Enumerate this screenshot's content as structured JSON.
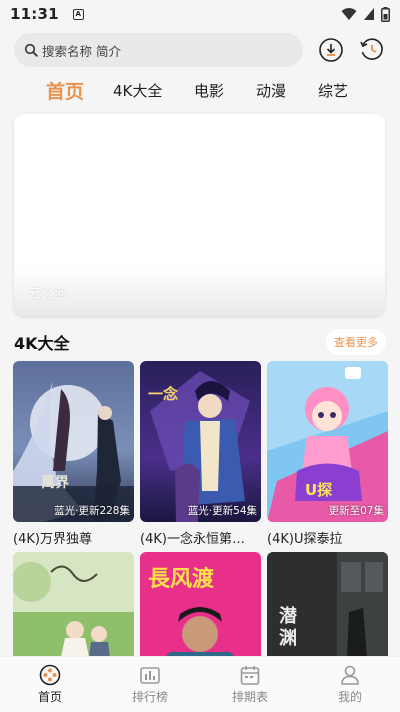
{
  "statusbar": {
    "time": "11:31"
  },
  "search": {
    "placeholder": "搜索名称 简介"
  },
  "tabs": [
    "首页",
    "4K大全",
    "电影",
    "动漫",
    "综艺"
  ],
  "active_tab": "首页",
  "banner": {
    "caption": "云之羽"
  },
  "section": {
    "title": "4K大全",
    "more": "查看更多"
  },
  "cards": [
    {
      "title": "(4K)万界独尊",
      "badge": "蓝光·更新228集"
    },
    {
      "title": "(4K)一念永恒第…",
      "badge": "蓝光·更新54集"
    },
    {
      "title": "(4K)U探泰拉",
      "badge": "更新至07集"
    }
  ],
  "poster_text": {
    "p2": "長风渡"
  },
  "bottom_nav": [
    "首页",
    "排行榜",
    "排期表",
    "我的"
  ],
  "colors": {
    "accent": "#e8924f",
    "background": "#f5f5f5",
    "search_bg": "#e9e9e9"
  },
  "icons": {
    "search": "search-icon",
    "history": "download-icon",
    "record": "history-icon",
    "home": "film-reel-icon",
    "rank": "chart-icon",
    "schedule": "calendar-icon",
    "me": "user-icon"
  }
}
